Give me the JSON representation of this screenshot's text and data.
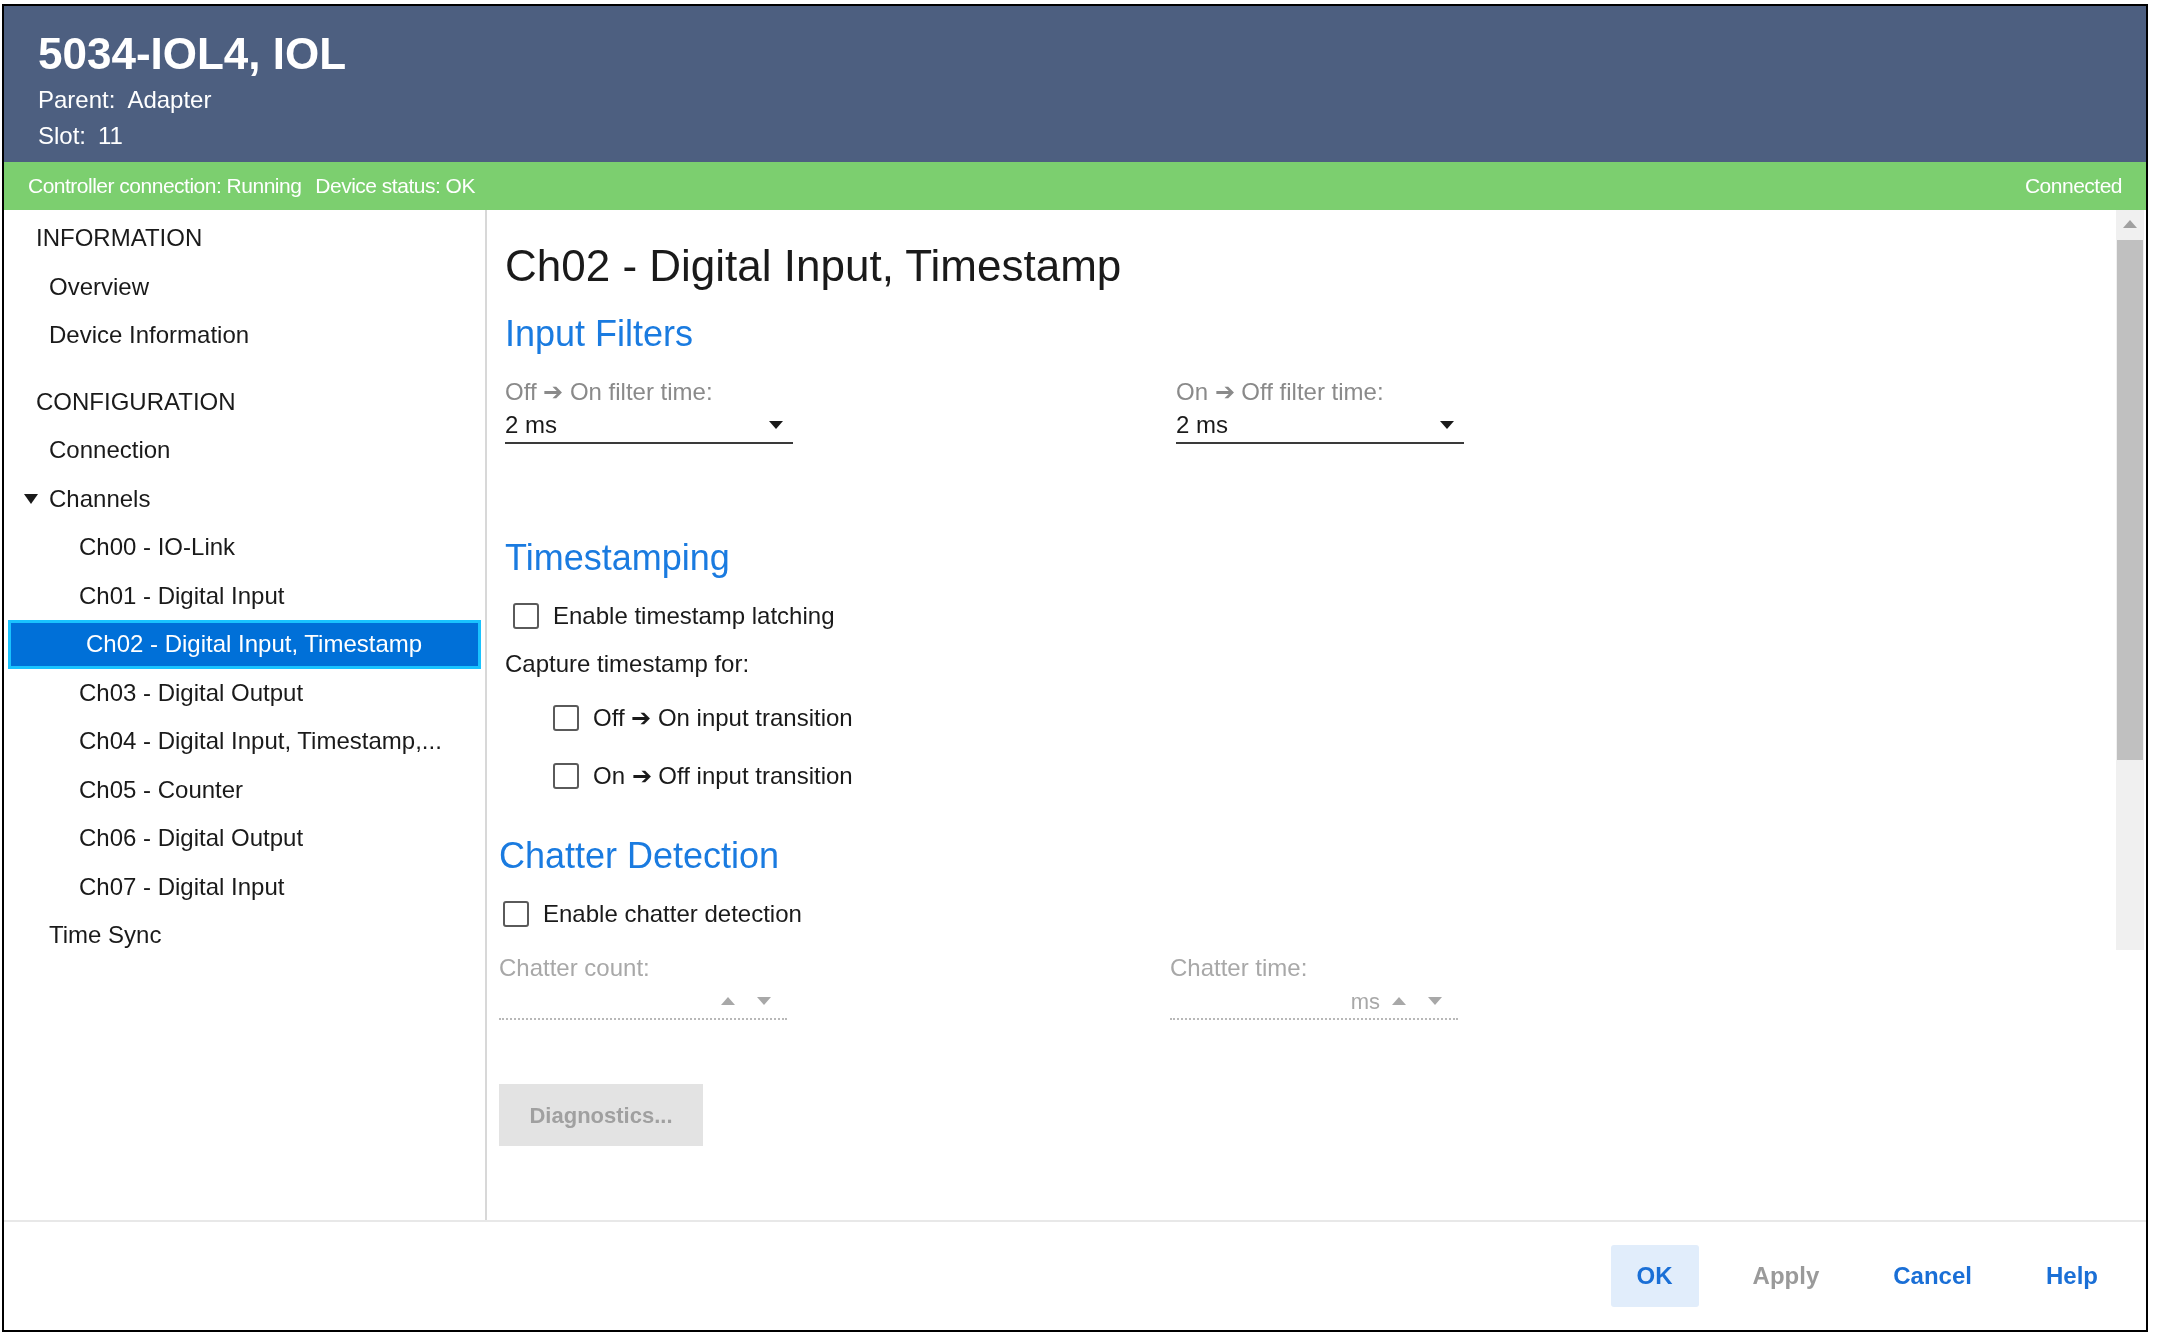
{
  "header": {
    "title": "5034-IOL4, IOL",
    "fields": [
      {
        "label": "Parent:",
        "value": "Adapter"
      },
      {
        "label": "Slot:",
        "value": "11"
      }
    ]
  },
  "status_bar": {
    "items": [
      "Controller connection: Running",
      "Device status: OK"
    ],
    "connection": "Connected"
  },
  "sidebar": {
    "groups": [
      {
        "heading": "INFORMATION",
        "items": [
          {
            "label": "Overview",
            "selected": false
          },
          {
            "label": "Device Information",
            "selected": false
          }
        ]
      },
      {
        "heading": "CONFIGURATION",
        "items": [
          {
            "label": "Connection",
            "selected": false
          },
          {
            "label": "Channels",
            "selected": false,
            "expanded": true,
            "children": [
              {
                "label": "Ch00 - IO-Link",
                "selected": false
              },
              {
                "label": "Ch01 - Digital Input",
                "selected": false
              },
              {
                "label": "Ch02 - Digital Input, Timestamp",
                "selected": true
              },
              {
                "label": "Ch03 - Digital Output",
                "selected": false
              },
              {
                "label": "Ch04 - Digital Input, Timestamp,...",
                "selected": false
              },
              {
                "label": "Ch05 - Counter",
                "selected": false
              },
              {
                "label": "Ch06 - Digital Output",
                "selected": false
              },
              {
                "label": "Ch07 - Digital Input",
                "selected": false
              }
            ]
          },
          {
            "label": "Time Sync",
            "selected": false
          }
        ]
      }
    ]
  },
  "page": {
    "title": "Ch02 - Digital Input, Timestamp",
    "input_filters": {
      "heading": "Input Filters",
      "fields": [
        {
          "label": "Off ➔ On filter time:",
          "value": "2 ms"
        },
        {
          "label": "On ➔ Off filter time:",
          "value": "2 ms"
        }
      ]
    },
    "timestamping": {
      "heading": "Timestamping",
      "latching": {
        "label": "Enable timestamp latching",
        "checked": false
      },
      "capture_label": "Capture timestamp for:",
      "options": [
        {
          "label": "Off ➔ On input transition",
          "checked": false
        },
        {
          "label": "On ➔ Off input transition",
          "checked": false
        }
      ]
    },
    "chatter": {
      "heading": "Chatter Detection",
      "enable": {
        "label": "Enable chatter detection",
        "checked": false
      },
      "fields": [
        {
          "label": "Chatter count:",
          "disabled": true
        },
        {
          "label": "Chatter time:",
          "unit": "ms",
          "disabled": true
        }
      ]
    },
    "diagnostics_button": {
      "label": "Diagnostics...",
      "disabled": true
    }
  },
  "buttons": [
    {
      "label": "OK",
      "default": true,
      "disabled": false
    },
    {
      "label": "Apply",
      "default": false,
      "disabled": true
    },
    {
      "label": "Cancel",
      "default": false,
      "disabled": false
    },
    {
      "label": "Help",
      "default": false,
      "disabled": false
    }
  ]
}
